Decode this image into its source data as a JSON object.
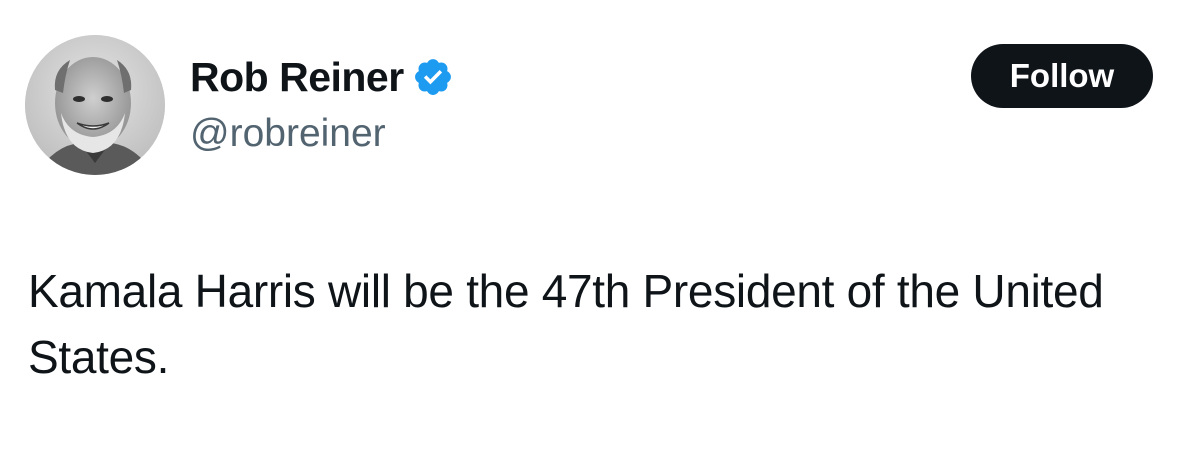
{
  "author": {
    "display_name": "Rob Reiner",
    "handle": "@robreiner",
    "verified_icon": "verified-badge-icon",
    "verified_color": "#1d9bf0"
  },
  "follow_button": {
    "label": "Follow",
    "background": "#0f1419"
  },
  "tweet": {
    "text": "Kamala Harris will be the 47th President of the United States."
  }
}
